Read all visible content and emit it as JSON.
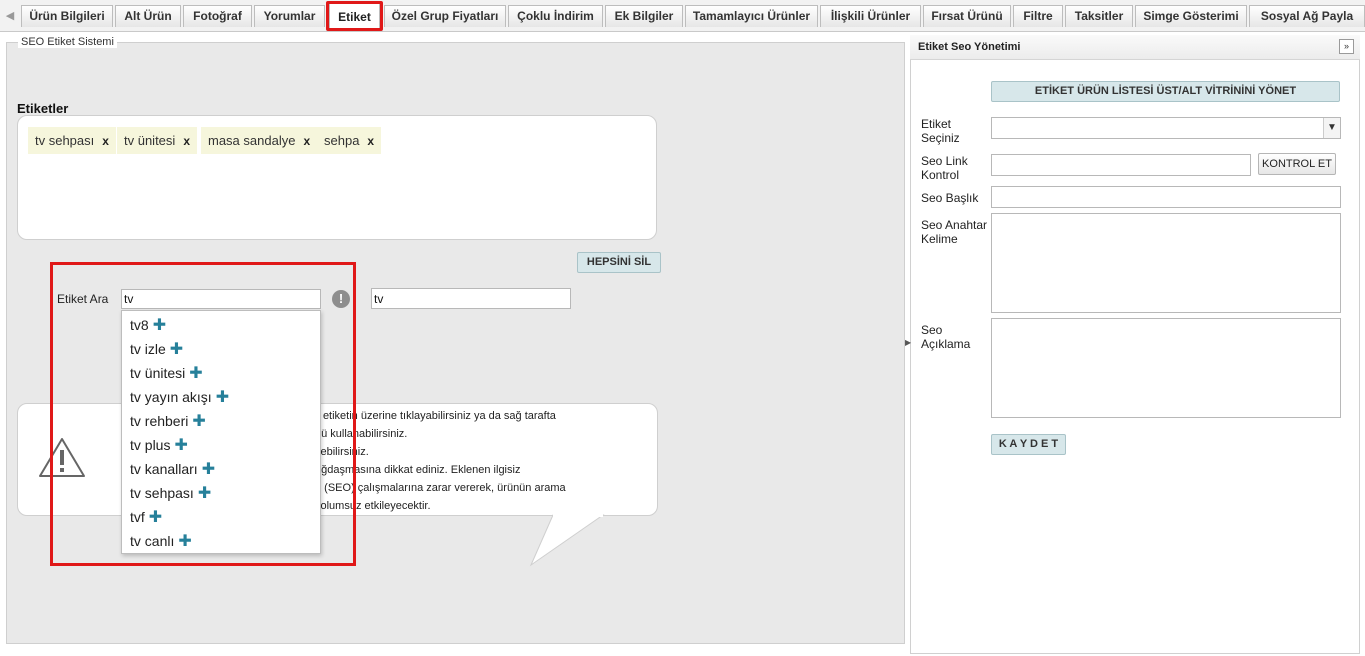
{
  "tabs": [
    {
      "label": "Ürün Bilgileri"
    },
    {
      "label": "Alt Ürün"
    },
    {
      "label": "Fotoğraf"
    },
    {
      "label": "Yorumlar"
    },
    {
      "label": "Etiket"
    },
    {
      "label": "Özel Grup Fiyatları"
    },
    {
      "label": "Çoklu İndirim"
    },
    {
      "label": "Ek Bilgiler"
    },
    {
      "label": "Tamamlayıcı Ürünler"
    },
    {
      "label": "İlişkili Ürünler"
    },
    {
      "label": "Fırsat Ürünü"
    },
    {
      "label": "Filtre"
    },
    {
      "label": "Taksitler"
    },
    {
      "label": "Simge Gösterimi"
    },
    {
      "label": "Sosyal Ağ Payla"
    }
  ],
  "left": {
    "legend": "SEO Etiket Sistemi",
    "tags_title": "Etiketler",
    "tags": [
      {
        "label": "tv sehpası",
        "remove": "x"
      },
      {
        "label": "tv ünitesi",
        "remove": "x"
      },
      {
        "label": "masa sandalye",
        "remove": "x"
      },
      {
        "label": "sehpa",
        "remove": "x"
      }
    ],
    "delete_all_label": "HEPSİNİ SİL",
    "search_label": "Etiket Ara",
    "search_value": "tv",
    "second_input_value": "tv",
    "warn_glyph": "!",
    "info_lines": [
      "li etiketin üzerine tıklayabilirsiniz ya da sağ tarafta",
      "nü kullanabilirsiniz.",
      "yebilirsiniz.",
      "ağdaşmasına dikkat ediniz. Eklenen ilgisiz",
      "n (SEO) çalışmalarına zarar vererek, ürünün arama",
      "i olumsuz etkileyecektir."
    ],
    "suggestions": [
      {
        "label": "tv8"
      },
      {
        "label": "tv izle"
      },
      {
        "label": "tv ünitesi"
      },
      {
        "label": "tv yayın akışı"
      },
      {
        "label": "tv rehberi"
      },
      {
        "label": "tv plus"
      },
      {
        "label": "tv kanalları"
      },
      {
        "label": "tv sehpası"
      },
      {
        "label": "tvf"
      },
      {
        "label": "tv canlı"
      }
    ],
    "plus_glyph": "✚"
  },
  "right": {
    "title": "Etiket Seo Yönetimi",
    "collapse_glyph": "»",
    "manage_button": "ETİKET ÜRÜN LİSTESİ ÜST/ALT VİTRİNİNİ YÖNET",
    "etiket_label_1": "Etiket",
    "etiket_label_2": "Seçiniz",
    "seo_link_label_1": "Seo Link",
    "seo_link_label_2": "Kontrol",
    "check_button": "KONTROL ET",
    "seo_title_label": "Seo Başlık",
    "seo_keyword_label_1": "Seo Anahtar",
    "seo_keyword_label_2": "Kelime",
    "seo_desc_label_1": "Seo",
    "seo_desc_label_2": "Açıklama",
    "save_button": "K A Y D E T"
  },
  "colors": {
    "highlight": "#e01818",
    "plus": "#26809a",
    "tag_bg": "#f6f6dc",
    "button_bg": "#d7e7ea"
  }
}
